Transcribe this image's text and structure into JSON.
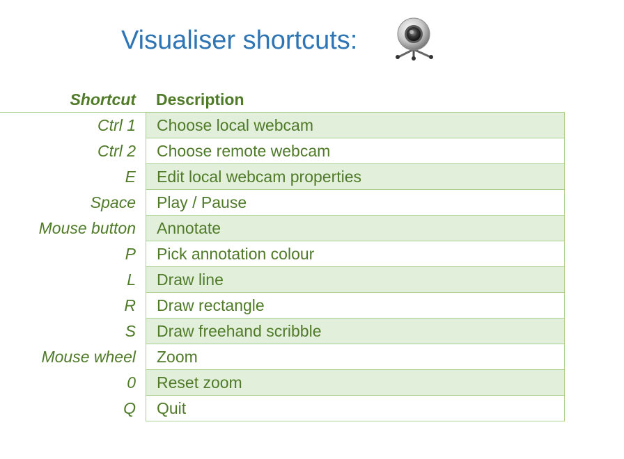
{
  "title": "Visualiser shortcuts:",
  "icon": "webcam-icon",
  "colors": {
    "title": "#2e75b6",
    "text": "#4f7a28",
    "band": "#e2efda",
    "border": "#a9d08e"
  },
  "table": {
    "headers": {
      "shortcut": "Shortcut",
      "description": "Description"
    },
    "rows": [
      {
        "key": "Ctrl 1",
        "desc": "Choose local webcam"
      },
      {
        "key": "Ctrl 2",
        "desc": "Choose remote webcam"
      },
      {
        "key": "E",
        "desc": "Edit local webcam properties"
      },
      {
        "key": "Space",
        "desc": "Play / Pause"
      },
      {
        "key": "Mouse button",
        "desc": "Annotate"
      },
      {
        "key": "P",
        "desc": "Pick annotation colour"
      },
      {
        "key": "L",
        "desc": "Draw line"
      },
      {
        "key": "R",
        "desc": "Draw rectangle"
      },
      {
        "key": "S",
        "desc": "Draw freehand scribble"
      },
      {
        "key": "Mouse wheel",
        "desc": "Zoom"
      },
      {
        "key": "0",
        "desc": "Reset zoom"
      },
      {
        "key": "Q",
        "desc": "Quit"
      }
    ]
  }
}
